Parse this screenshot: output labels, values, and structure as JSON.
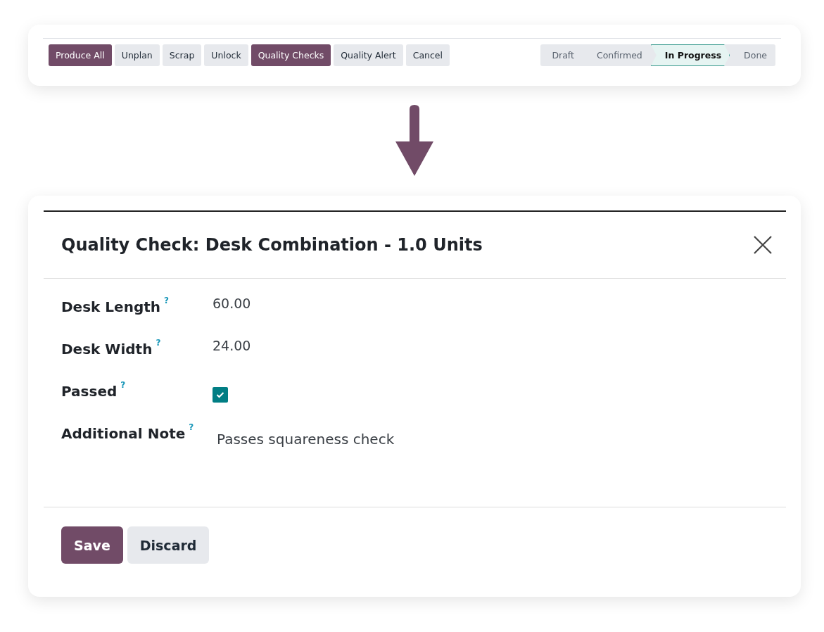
{
  "toolbar": {
    "buttons": [
      {
        "label": "Produce All",
        "kind": "primary"
      },
      {
        "label": "Unplan",
        "kind": "secondary"
      },
      {
        "label": "Scrap",
        "kind": "secondary"
      },
      {
        "label": "Unlock",
        "kind": "secondary"
      },
      {
        "label": "Quality Checks",
        "kind": "primary"
      },
      {
        "label": "Quality Alert",
        "kind": "secondary"
      },
      {
        "label": "Cancel",
        "kind": "secondary"
      }
    ],
    "status_steps": [
      {
        "label": "Draft",
        "selected": false
      },
      {
        "label": "Confirmed",
        "selected": false
      },
      {
        "label": "In Progress",
        "selected": true
      },
      {
        "label": "Done",
        "selected": false
      }
    ]
  },
  "dialog": {
    "title": "Quality Check: Desk Combination - 1.0 Units",
    "fields": [
      {
        "label": "Desk Length",
        "help": "?",
        "kind": "number",
        "value": "60.00"
      },
      {
        "label": "Desk Width",
        "help": "?",
        "kind": "number",
        "value": "24.00"
      },
      {
        "label": "Passed",
        "help": "?",
        "kind": "checkbox",
        "checked": true
      },
      {
        "label": "Additional Note",
        "help": "?",
        "kind": "text",
        "value": "Passes squareness check"
      }
    ],
    "buttons": [
      {
        "label": "Save",
        "kind": "primary"
      },
      {
        "label": "Discard",
        "kind": "secondary"
      }
    ]
  }
}
